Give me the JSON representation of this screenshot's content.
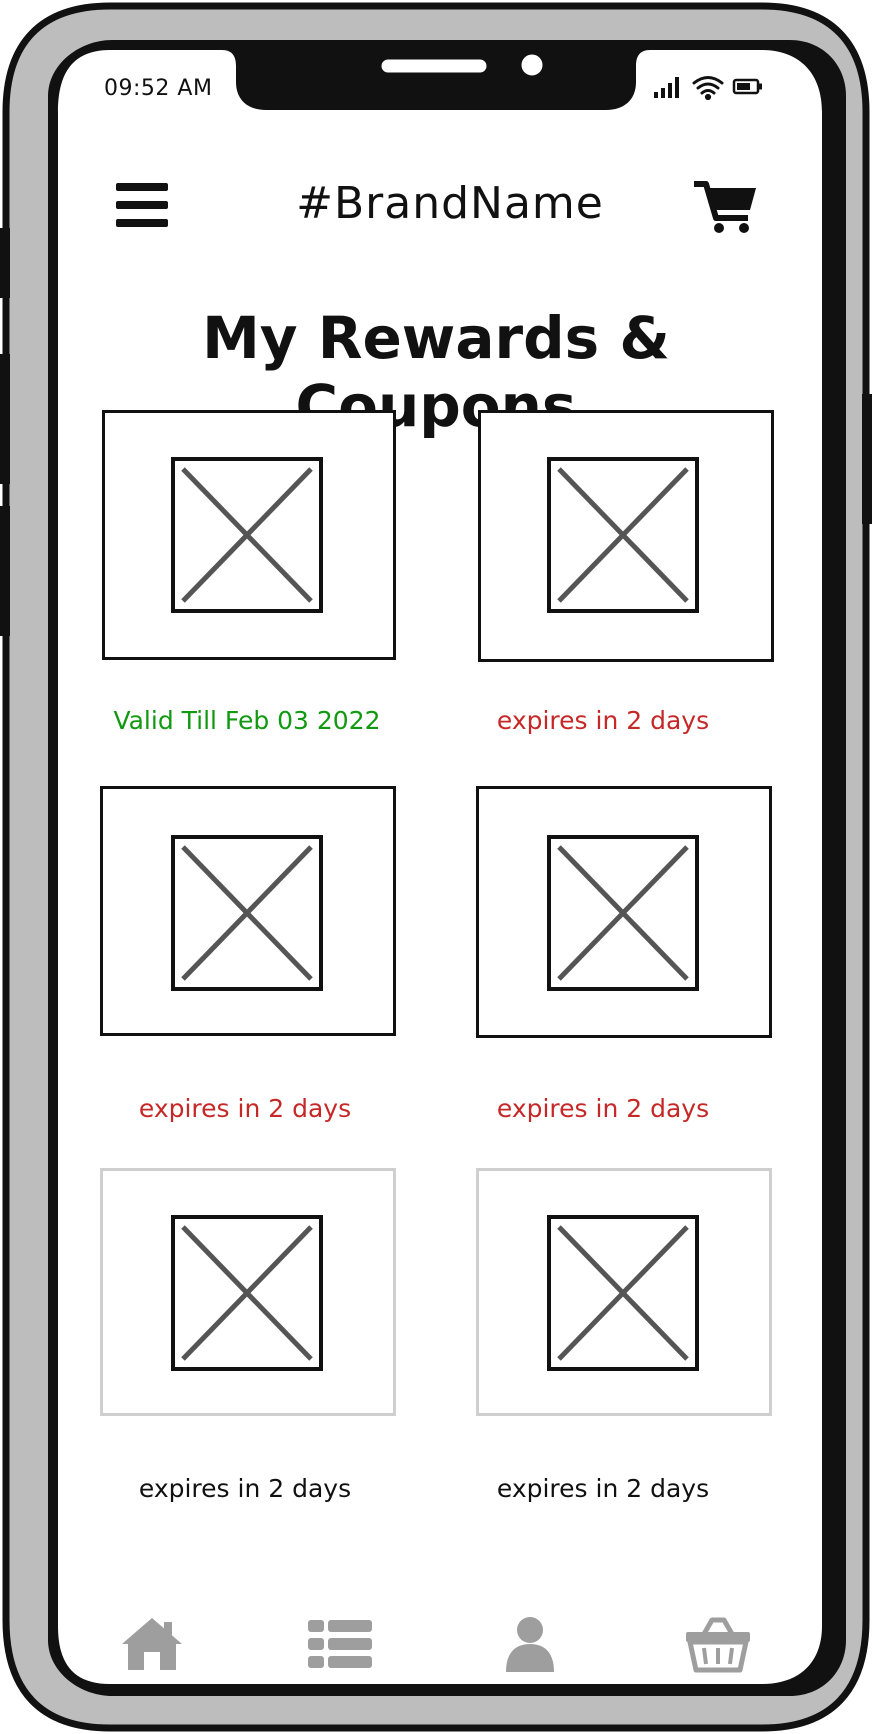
{
  "status_bar": {
    "time": "09:52 AM",
    "signal_icon": "signal-bars-icon",
    "wifi_icon": "wifi-icon",
    "battery_icon": "battery-icon"
  },
  "header": {
    "menu_icon": "hamburger-menu-icon",
    "brand": "#BrandName",
    "cart_icon": "shopping-cart-icon"
  },
  "page": {
    "title": "My Rewards & Coupons"
  },
  "coupons": [
    {
      "caption": "Valid Till Feb 03 2022",
      "caption_color": "#119a11",
      "state": "active",
      "image_icon": "image-placeholder-icon"
    },
    {
      "caption": "expires in 2 days",
      "caption_color": "#c62828",
      "state": "active",
      "image_icon": "image-placeholder-icon"
    },
    {
      "caption": "expires in 2 days",
      "caption_color": "#c62828",
      "state": "active",
      "image_icon": "image-placeholder-icon"
    },
    {
      "caption": "expires in 2 days",
      "caption_color": "#c62828",
      "state": "active",
      "image_icon": "image-placeholder-icon"
    },
    {
      "caption": "expires in 2 days",
      "caption_color": "#111111",
      "state": "disabled",
      "image_icon": "image-placeholder-icon"
    },
    {
      "caption": "expires in 2 days",
      "caption_color": "#111111",
      "state": "disabled",
      "image_icon": "image-placeholder-icon"
    }
  ],
  "bottom_nav": {
    "items": [
      {
        "icon": "home-icon"
      },
      {
        "icon": "list-icon"
      },
      {
        "icon": "user-icon"
      },
      {
        "icon": "basket-icon"
      }
    ],
    "icon_color": "#9e9e9e"
  },
  "colors": {
    "device_frame": "#bdbdbd",
    "outline": "#111111",
    "accent_green": "#119a11",
    "accent_red": "#c62828",
    "disabled_border": "#cfcfcf"
  }
}
